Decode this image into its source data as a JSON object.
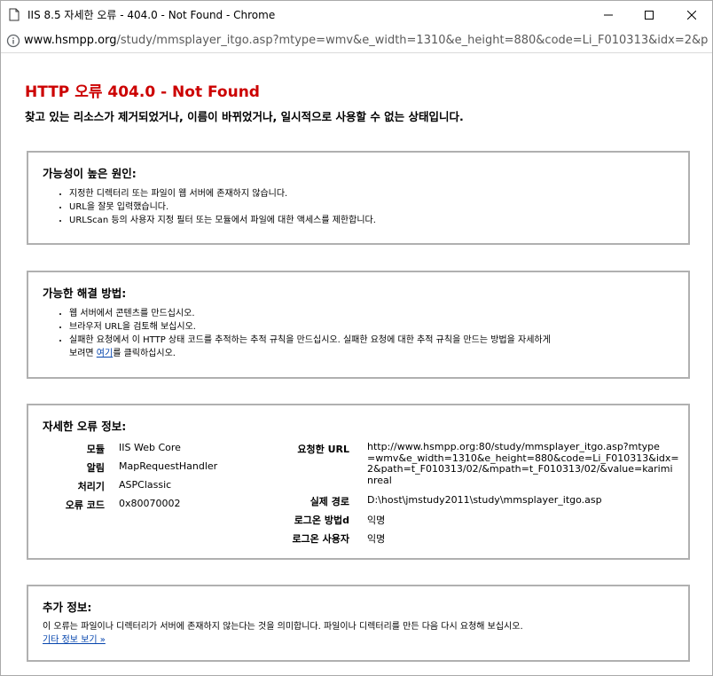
{
  "window": {
    "title": "IIS 8.5 자세한 오류 - 404.0 - Not Found - Chrome"
  },
  "address": {
    "host": "www.hsmpp.org",
    "path": "/study/mmsplayer_itgo.asp?mtype=wmv&e_width=1310&e_height=880&code=Li_F010313&idx=2&pat..."
  },
  "error": {
    "title": "HTTP 오류 404.0 - Not Found",
    "subtitle": "찾고 있는 리소스가 제거되었거나, 이름이 바뀌었거나, 일시적으로 사용할 수 없는 상태입니다."
  },
  "causes": {
    "heading": "가능성이 높은 원인:",
    "items": [
      "지정한 디렉터리 또는 파일이 웹 서버에 존재하지 않습니다.",
      "URL을 잘못 입력했습니다.",
      "URLScan 등의 사용자 지정 필터 또는 모듈에서 파일에 대한 액세스를 제한합니다."
    ]
  },
  "solutions": {
    "heading": "가능한 해결 방법:",
    "items": [
      "웹 서버에서 콘텐츠를 만드십시오.",
      "브라우저 URL을 검토해 보십시오."
    ],
    "item3_line1": "실패한 요청에서 이 HTTP 상태 코드를 추적하는 추적 규칙을 만드십시오. 실패한 요청에 대한 추적 규칙을 만드는 방법을 자세하게",
    "item3_pre": "보려면 ",
    "item3_link": "여기",
    "item3_post": "를 클릭하십시오."
  },
  "details": {
    "heading": "자세한 오류 정보:",
    "left": [
      {
        "label": "모듈",
        "value": "IIS Web Core"
      },
      {
        "label": "알림",
        "value": "MapRequestHandler"
      },
      {
        "label": "처리기",
        "value": "ASPClassic"
      },
      {
        "label": "오류 코드",
        "value": "0x80070002"
      }
    ],
    "requested_url_label": "요청한 URL",
    "requested_url_lines": [
      "http://www.hsmpp.org:80/study/mmsplayer_itgo.asp?mtype",
      "=wmv&e_width=1310&e_height=880&code=Li_F010313&idx=",
      "2&path=t_F010313/02/&mpath=t_F010313/02/&value=karimi",
      "nreal"
    ],
    "right": [
      {
        "label": "실제 경로",
        "value": "D:\\host\\jmstudy2011\\study\\mmsplayer_itgo.asp"
      },
      {
        "label": "로그온 방법d",
        "value": "익명"
      },
      {
        "label": "로그온 사용자",
        "value": "익명"
      }
    ]
  },
  "more": {
    "heading": "추가 정보:",
    "text": "이 오류는 파일이나 디렉터리가 서버에 존재하지 않는다는 것을 의미합니다. 파일이나 디렉터리를 만든 다음 다시 요청해 보십시오.",
    "link": "기타 정보 보기 »"
  }
}
